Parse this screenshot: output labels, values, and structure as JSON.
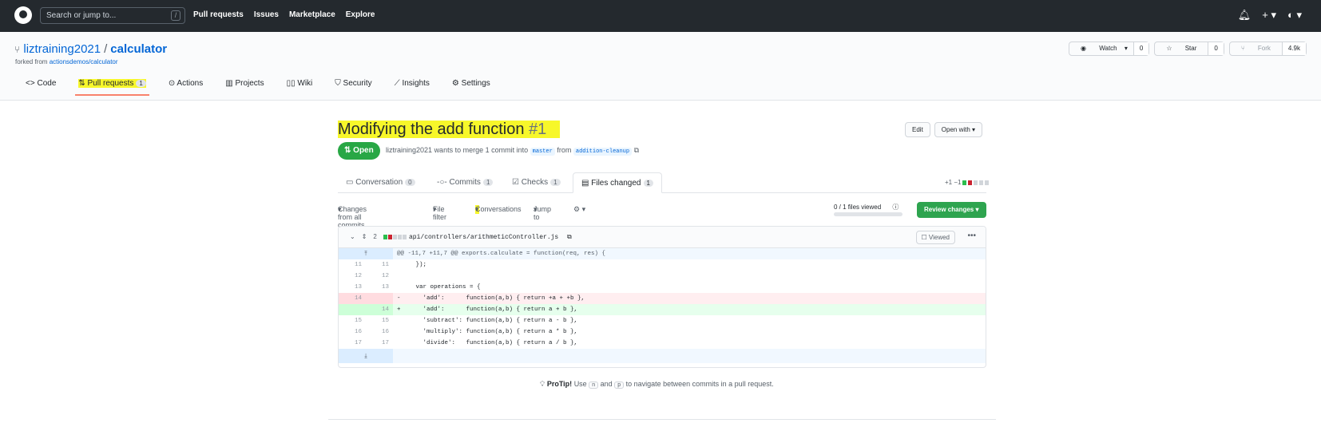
{
  "header": {
    "search_placeholder": "Search or jump to...",
    "search_key": "/",
    "nav": [
      "Pull requests",
      "Issues",
      "Marketplace",
      "Explore"
    ]
  },
  "repo": {
    "owner": "liztraining2021",
    "name": "calculator",
    "forked_prefix": "forked from",
    "forked_from": "actionsdemos/calculator",
    "watch_label": "Watch",
    "watch_count": "0",
    "star_label": "Star",
    "star_count": "0",
    "fork_label": "Fork",
    "fork_count": "4.9k",
    "tabs": {
      "code": "Code",
      "pulls": "Pull requests",
      "pulls_count": "1",
      "actions": "Actions",
      "projects": "Projects",
      "wiki": "Wiki",
      "security": "Security",
      "insights": "Insights",
      "settings": "Settings"
    }
  },
  "pr": {
    "title": "Modifying the add function",
    "number": "#1",
    "edit_label": "Edit",
    "open_with_label": "Open with",
    "state": "Open",
    "author": "liztraining2021",
    "merge_text": "wants to merge 1 commit into",
    "base": "master",
    "from_text": "from",
    "head": "addition-cleanup",
    "tabs": {
      "conversation": "Conversation",
      "conversation_count": "0",
      "commits": "Commits",
      "commits_count": "1",
      "checks": "Checks",
      "checks_count": "1",
      "files": "Files changed",
      "files_count": "1"
    },
    "diffstat": "+1 −1"
  },
  "toolbar": {
    "changes_from": "Changes from all commits",
    "file_filter": "File filter",
    "conversations": "Conversations",
    "jump_to": "Jump to",
    "files_viewed": "0 / 1 files viewed",
    "review_changes": "Review changes"
  },
  "file": {
    "change_count": "2",
    "path": "api/controllers/arithmeticController.js",
    "viewed_label": "Viewed",
    "hunk_header": "@@ -11,7 +11,7 @@ exports.calculate = function(req, res) {",
    "lines": {
      "l1": {
        "old": "11",
        "new": "11",
        "code": "  });"
      },
      "l2": {
        "old": "12",
        "new": "12",
        "code": ""
      },
      "l3": {
        "old": "13",
        "new": "13",
        "code": "  var operations = {"
      },
      "l4": {
        "old": "14",
        "new": "",
        "sign": "-",
        "code": "    'add':      function(a,b) { return +a + +b },"
      },
      "l5": {
        "old": "",
        "new": "14",
        "sign": "+",
        "code": "    'add':      function(a,b) { return a + b },"
      },
      "l6": {
        "old": "15",
        "new": "15",
        "code": "    'subtract': function(a,b) { return a - b },"
      },
      "l7": {
        "old": "16",
        "new": "16",
        "code": "    'multiply': function(a,b) { return a * b },"
      },
      "l8": {
        "old": "17",
        "new": "17",
        "code": "    'divide':   function(a,b) { return a / b },"
      }
    }
  },
  "protip": {
    "label": "ProTip!",
    "text1": "Use",
    "key1": "n",
    "text2": "and",
    "key2": "p",
    "text3": "to navigate between commits in a pull request."
  },
  "colors": {
    "header_bg": "#24292e",
    "open_green": "#28a745",
    "highlight": "#f7f72a",
    "link_blue": "#0366d6"
  }
}
